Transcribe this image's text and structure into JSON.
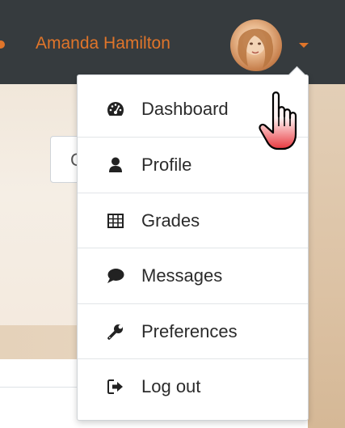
{
  "header": {
    "user_name": "Amanda Hamilton",
    "accent_color": "#e0752a",
    "bar_color": "#363b3e",
    "avatar_icon": "user-avatar",
    "caret_icon": "caret-down-icon"
  },
  "background": {
    "search_fragment": "C"
  },
  "user_menu": {
    "items": [
      {
        "label": "Dashboard",
        "icon": "tachometer-icon"
      },
      {
        "label": "Profile",
        "icon": "user-icon"
      },
      {
        "label": "Grades",
        "icon": "table-icon"
      },
      {
        "label": "Messages",
        "icon": "comment-icon"
      },
      {
        "label": "Preferences",
        "icon": "wrench-icon"
      },
      {
        "label": "Log out",
        "icon": "sign-out-icon"
      }
    ]
  },
  "cursor": {
    "icon": "hand-pointer-cursor"
  }
}
